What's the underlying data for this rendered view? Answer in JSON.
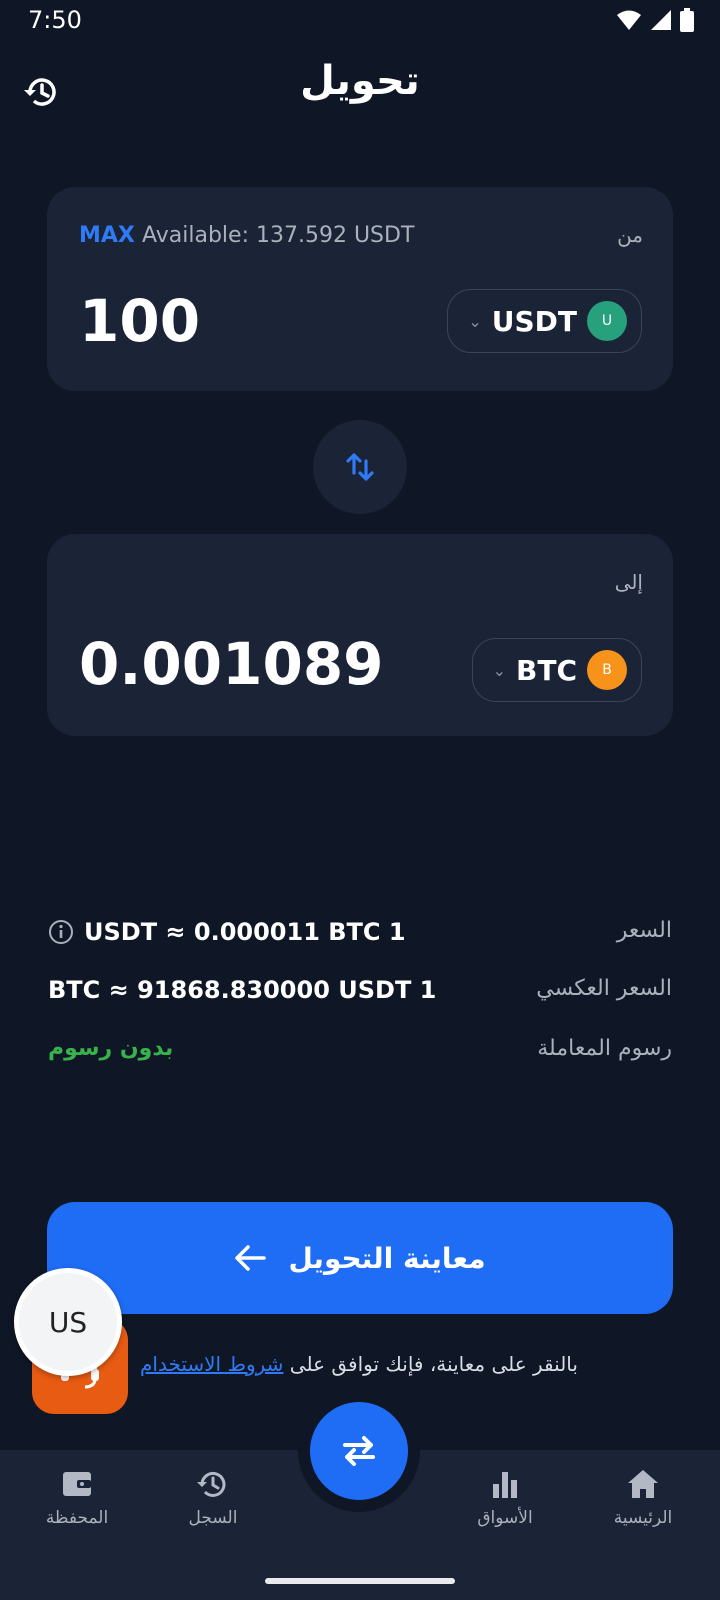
{
  "status_bar": {
    "time": "7:50"
  },
  "header": {
    "title": "تحويل"
  },
  "from_card": {
    "label": "من",
    "max_label": "MAX",
    "available_text": "Available: 137.592 USDT",
    "amount": "100",
    "token": "USDT",
    "token_icon_letter": "U",
    "token_icon_color": "#26a17b"
  },
  "to_card": {
    "label": "إلى",
    "amount": "0.001089",
    "token": "BTC",
    "token_icon_letter": "B",
    "token_icon_color": "#f7931a"
  },
  "info": {
    "price_label": "السعر",
    "price_value": "USDT ≈ 0.000011 BTC 1",
    "reverse_label": "السعر العكسي",
    "reverse_value": "BTC ≈ 91868.830000 USDT 1",
    "fee_label": "رسوم المعاملة",
    "fee_value": "بدون رسوم"
  },
  "cta": {
    "label": "معاينة التحويل"
  },
  "terms": {
    "prefix": "بالنقر على معاينة، فإنك توافق على",
    "link": "شروط الاستخدام"
  },
  "support": {
    "badge": "US"
  },
  "bottom_nav": {
    "items": [
      {
        "label": "الرئيسية",
        "icon": "home-icon"
      },
      {
        "label": "الأسواق",
        "icon": "bar-chart-icon"
      },
      {
        "label": "السجل",
        "icon": "history-icon"
      },
      {
        "label": "المحفظة",
        "icon": "wallet-icon"
      }
    ]
  },
  "colors": {
    "accent": "#1f6cf5",
    "background": "#0f1625",
    "card": "#1b2436",
    "success": "#38b24a"
  }
}
